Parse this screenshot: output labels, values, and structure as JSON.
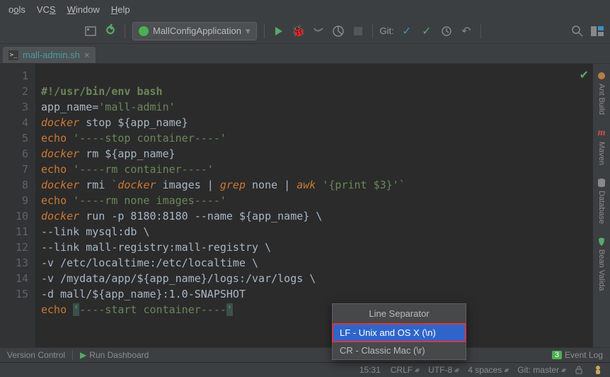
{
  "menubar": {
    "items": [
      {
        "label": "ools",
        "u": "o"
      },
      {
        "label": "VCS",
        "u": "S"
      },
      {
        "label": "Window",
        "u": "W"
      },
      {
        "label": "Help",
        "u": "H"
      }
    ]
  },
  "toolbar": {
    "run_config": "MallConfigApplication",
    "git_label": "Git:",
    "icons": {
      "picker": "picker-icon",
      "hammer": "build-icon",
      "spring": "spring-icon",
      "dropdown": "dropdown-chevron-icon",
      "run": "run-icon",
      "debug": "debug-icon",
      "coverage": "coverage-icon",
      "profile": "profile-icon",
      "stop": "stop-icon",
      "update": "git-update-icon",
      "commit": "git-commit-icon",
      "history": "git-history-icon",
      "revert": "git-revert-icon",
      "search": "search-icon",
      "structure": "structure-icon"
    }
  },
  "tabs": {
    "active": {
      "name": "mall-admin.sh",
      "icon": "terminal-icon"
    }
  },
  "gutter_lines": [
    "1",
    "2",
    "3",
    "4",
    "5",
    "6",
    "7",
    "8",
    "9",
    "10",
    "11",
    "12",
    "13",
    "14",
    "15"
  ],
  "code": {
    "l1_shebang": "#!/usr/bin/env bash",
    "l2a": "app_name=",
    "l2b": "'mall-admin'",
    "l3a": "docker",
    "l3b": " stop ${app_name}",
    "l4a": "echo",
    "l4b": " '----stop container----'",
    "l5a": "docker",
    "l5b": " rm ${app_name}",
    "l6a": "echo",
    "l6b": " '----rm container----'",
    "l7a": "docker",
    "l7b": " rmi ",
    "l7c": "`",
    "l7d": "docker",
    "l7e": " images | ",
    "l7f": "grep",
    "l7g": " none | ",
    "l7h": "awk",
    "l7i": " '{print $3}'",
    "l7j": "`",
    "l8a": "echo",
    "l8b": " '----rm none images----'",
    "l9a": "docker",
    "l9b": " run -p 8180:8180 --name ${app_name} \\",
    "l10": "--link mysql:db \\",
    "l11": "--link mall-registry:mall-registry \\",
    "l12": "-v /etc/localtime:/etc/localtime \\",
    "l13": "-v /mydata/app/${app_name}/logs:/var/logs \\",
    "l14": "-d mall/${app_name}:1.0-SNAPSHOT",
    "l15a": "echo",
    "l15b": " ",
    "l15c": "'",
    "l15d": "----start container----",
    "l15e": "'"
  },
  "popup": {
    "title": "Line Separator",
    "items": [
      "LF - Unix and OS X (\\n)",
      "CR - Classic Mac (\\r)"
    ]
  },
  "right_rail": {
    "items": [
      "Ant Build",
      "Maven",
      "Database",
      "Bean Valida"
    ]
  },
  "statusbar_upper": {
    "version_control": "Version Control",
    "run_dashboard": "Run Dashboard",
    "event_log": "Event Log",
    "event_badge": "3"
  },
  "statusbar_lower": {
    "cursor": "15:31",
    "line_sep": "CRLF",
    "encoding": "UTF-8",
    "indent": "4 spaces",
    "git": "Git: master"
  }
}
